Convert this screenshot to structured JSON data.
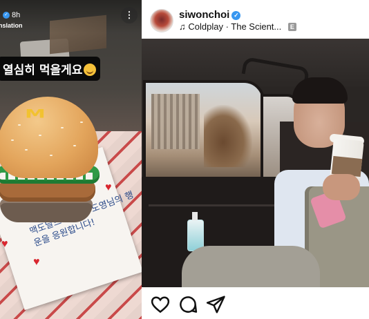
{
  "story": {
    "time": "8h",
    "translate_label": "nslation",
    "more_icon": "⋮",
    "caption": "열심히 먹을게요",
    "card_text": "맥도날드가 NCT 도영님의 행운을 응원합니다!",
    "card_color": "#2a4a8a"
  },
  "post": {
    "username": "siwonchoi",
    "verified": "✓",
    "music_icon": "♫",
    "music": "Coldplay · The Scient...",
    "explicit_badge": "E",
    "actions": [
      {
        "name": "like",
        "icon": "heart-icon"
      },
      {
        "name": "comment",
        "icon": "comment-icon"
      },
      {
        "name": "share",
        "icon": "send-icon"
      }
    ]
  }
}
